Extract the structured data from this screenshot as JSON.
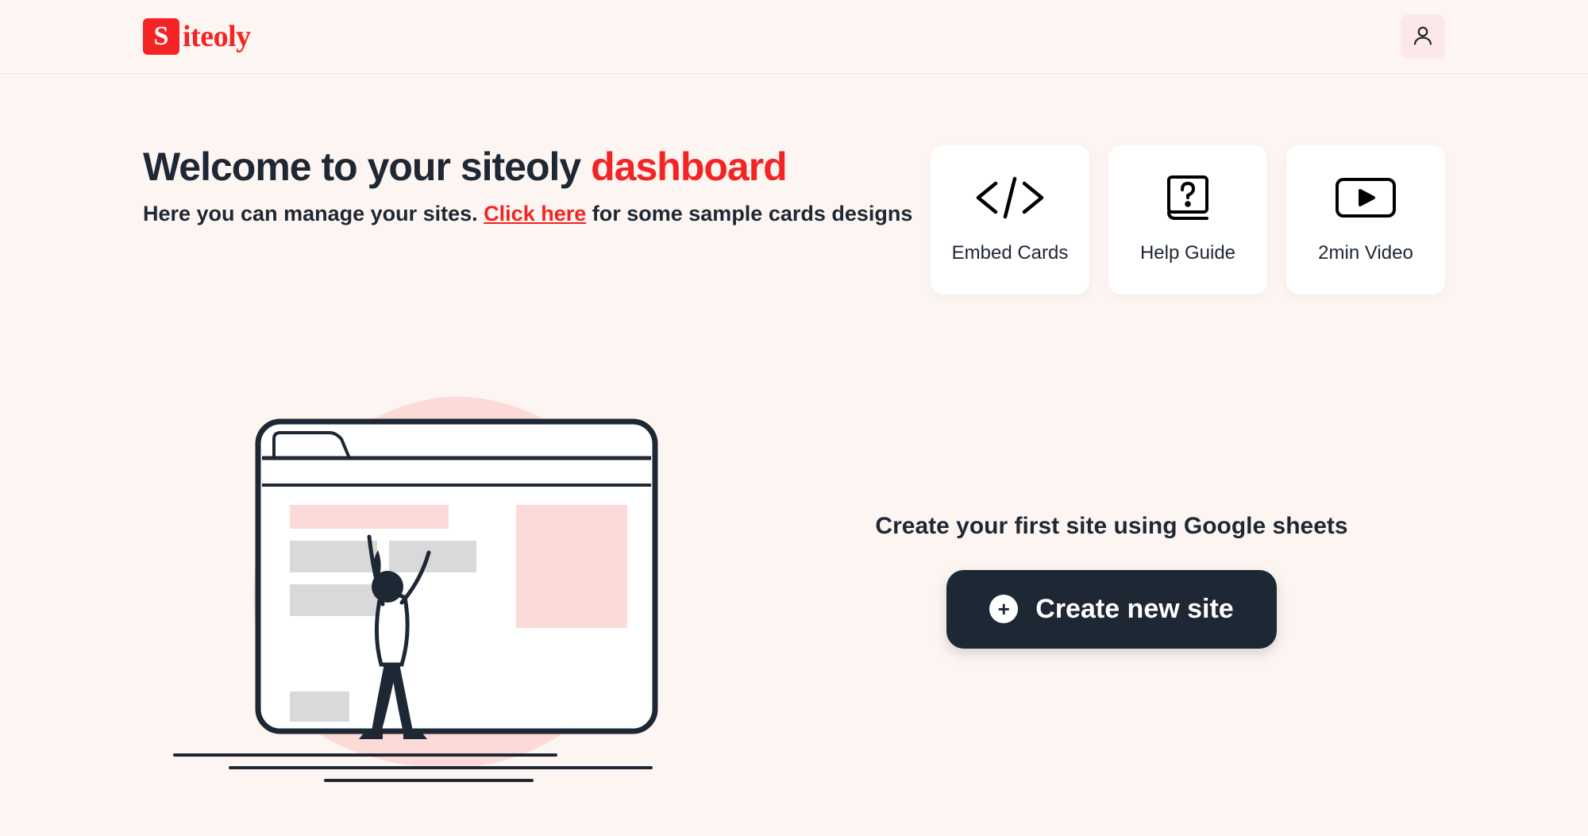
{
  "brand": {
    "letter": "S",
    "name": "iteoly"
  },
  "welcome": {
    "title_prefix": "Welcome to your siteoly ",
    "title_accent": "dashboard",
    "subtitle_prefix": "Here you can manage your sites. ",
    "subtitle_link": "Click here",
    "subtitle_suffix": " for some sample cards designs"
  },
  "cards": {
    "embed": "Embed Cards",
    "help": "Help Guide",
    "video": "2min Video"
  },
  "cta": {
    "prompt": "Create your first site using Google sheets",
    "button": "Create new site"
  },
  "colors": {
    "accent": "#f42424",
    "dark": "#1e2734",
    "bg": "#fdf5f1"
  }
}
